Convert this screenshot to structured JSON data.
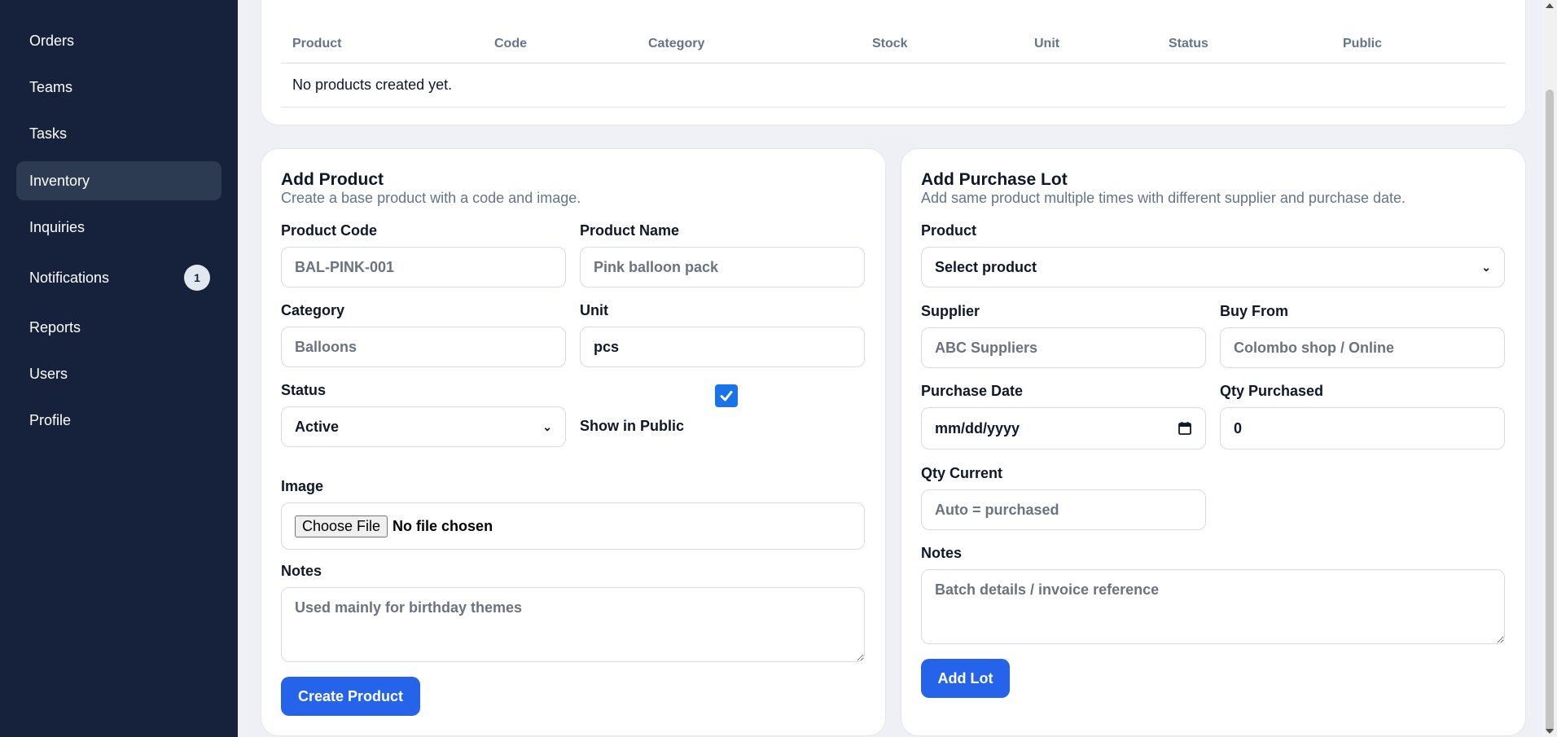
{
  "sidebar": {
    "items": [
      {
        "label": "Orders"
      },
      {
        "label": "Teams"
      },
      {
        "label": "Tasks"
      },
      {
        "label": "Inventory"
      },
      {
        "label": "Inquiries"
      },
      {
        "label": "Notifications",
        "badge": "1"
      },
      {
        "label": "Reports"
      },
      {
        "label": "Users"
      },
      {
        "label": "Profile"
      }
    ]
  },
  "products_table": {
    "columns": [
      "Product",
      "Code",
      "Category",
      "Stock",
      "Unit",
      "Status",
      "Public"
    ],
    "empty_message": "No products created yet."
  },
  "add_product": {
    "title": "Add Product",
    "subtitle": "Create a base product with a code and image.",
    "code_label": "Product Code",
    "code_placeholder": "BAL-PINK-001",
    "name_label": "Product Name",
    "name_placeholder": "Pink balloon pack",
    "category_label": "Category",
    "category_placeholder": "Balloons",
    "unit_label": "Unit",
    "unit_value": "pcs",
    "status_label": "Status",
    "status_value": "Active",
    "public_label": "Show in Public",
    "image_label": "Image",
    "file_button": "Choose File",
    "file_status": "No file chosen",
    "notes_label": "Notes",
    "notes_placeholder": "Used mainly for birthday themes",
    "submit_label": "Create Product"
  },
  "add_lot": {
    "title": "Add Purchase Lot",
    "subtitle": "Add same product multiple times with different supplier and purchase date.",
    "product_label": "Product",
    "product_value": "Select product",
    "supplier_label": "Supplier",
    "supplier_placeholder": "ABC Suppliers",
    "buy_from_label": "Buy From",
    "buy_from_placeholder": "Colombo shop / Online",
    "purchase_date_label": "Purchase Date",
    "purchase_date_value": "mm/dd/yyyy",
    "qty_purchased_label": "Qty Purchased",
    "qty_purchased_value": "0",
    "qty_current_label": "Qty Current",
    "qty_current_placeholder": "Auto = purchased",
    "notes_label": "Notes",
    "notes_placeholder": "Batch details / invoice reference",
    "submit_label": "Add Lot"
  },
  "colors": {
    "sidebar_bg": "#16223b",
    "active_item_bg": "#2c3a52",
    "primary": "#2563eb"
  }
}
